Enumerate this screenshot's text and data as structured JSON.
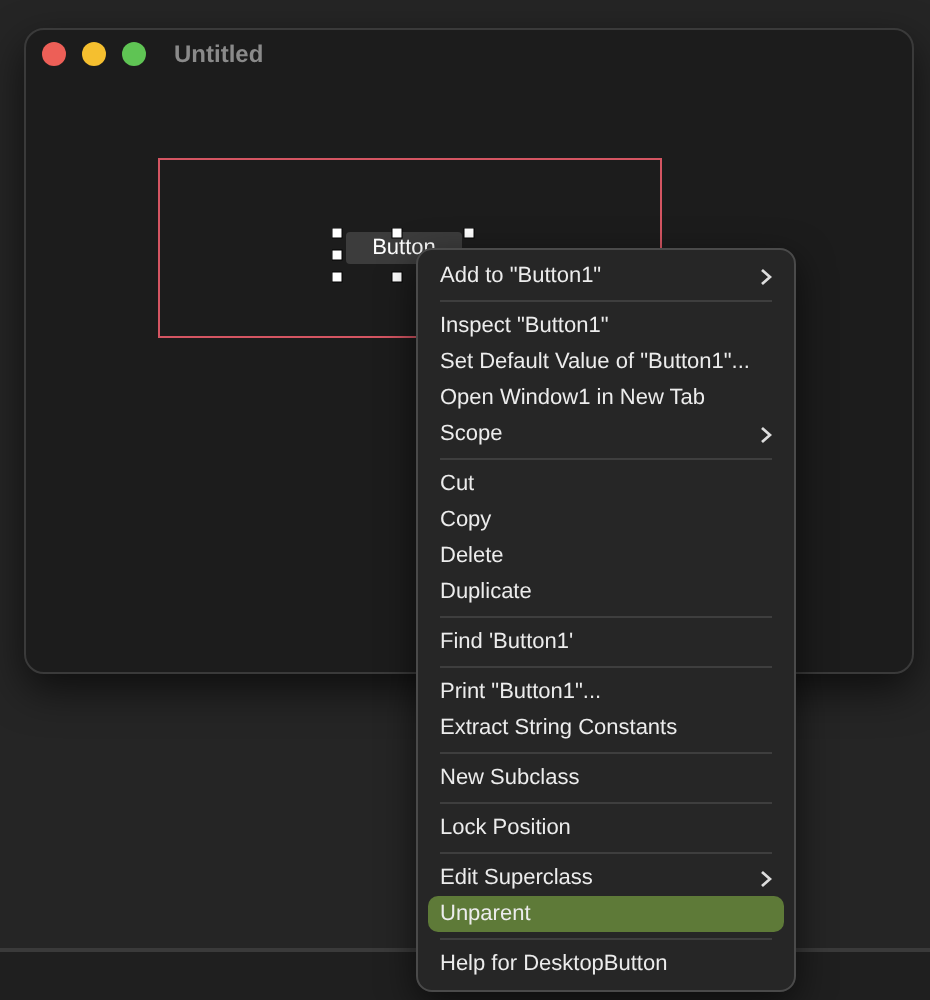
{
  "window": {
    "title": "Untitled"
  },
  "canvas": {
    "button": {
      "label": "Button",
      "selected": true
    }
  },
  "context_menu": [
    {
      "kind": "item",
      "label": "Add to \"Button1\"",
      "submenu": true,
      "selected": false
    },
    {
      "kind": "separator"
    },
    {
      "kind": "item",
      "label": "Inspect \"Button1\"",
      "submenu": false,
      "selected": false
    },
    {
      "kind": "item",
      "label": "Set Default Value of \"Button1\"...",
      "submenu": false,
      "selected": false
    },
    {
      "kind": "item",
      "label": "Open Window1 in New Tab",
      "submenu": false,
      "selected": false
    },
    {
      "kind": "item",
      "label": "Scope",
      "submenu": true,
      "selected": false
    },
    {
      "kind": "separator"
    },
    {
      "kind": "item",
      "label": "Cut",
      "submenu": false,
      "selected": false
    },
    {
      "kind": "item",
      "label": "Copy",
      "submenu": false,
      "selected": false
    },
    {
      "kind": "item",
      "label": "Delete",
      "submenu": false,
      "selected": false
    },
    {
      "kind": "item",
      "label": "Duplicate",
      "submenu": false,
      "selected": false
    },
    {
      "kind": "separator"
    },
    {
      "kind": "item",
      "label": "Find 'Button1'",
      "submenu": false,
      "selected": false
    },
    {
      "kind": "separator"
    },
    {
      "kind": "item",
      "label": "Print \"Button1\"...",
      "submenu": false,
      "selected": false
    },
    {
      "kind": "item",
      "label": "Extract String Constants",
      "submenu": false,
      "selected": false
    },
    {
      "kind": "separator"
    },
    {
      "kind": "item",
      "label": "New Subclass",
      "submenu": false,
      "selected": false
    },
    {
      "kind": "separator"
    },
    {
      "kind": "item",
      "label": "Lock Position",
      "submenu": false,
      "selected": false
    },
    {
      "kind": "separator"
    },
    {
      "kind": "item",
      "label": "Edit Superclass",
      "submenu": true,
      "selected": false
    },
    {
      "kind": "item",
      "label": "Unparent",
      "submenu": false,
      "selected": true
    },
    {
      "kind": "separator"
    },
    {
      "kind": "item",
      "label": "Help for DesktopButton",
      "submenu": false,
      "selected": false
    }
  ]
}
